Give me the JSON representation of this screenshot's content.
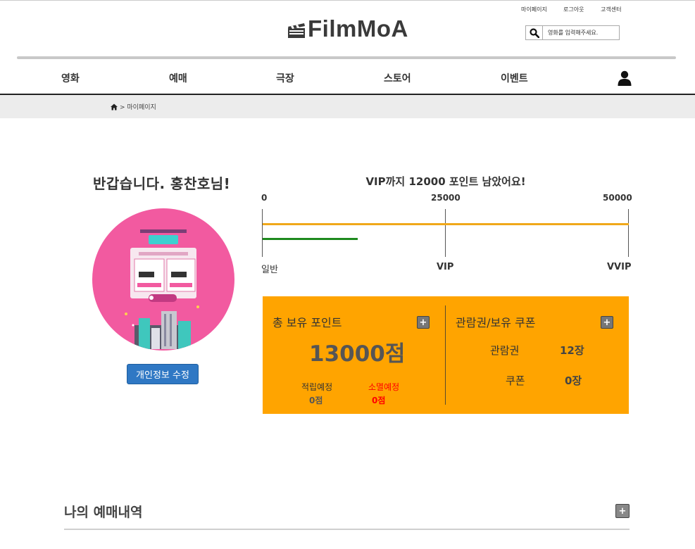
{
  "header": {
    "util_links": [
      "마이페이지",
      "로그아웃",
      "고객센터"
    ],
    "logo_text": "FilmMoA",
    "search_placeholder": "영화를 입력해주세요."
  },
  "nav": {
    "items": [
      "영화",
      "예매",
      "극장",
      "스토어",
      "이벤트"
    ]
  },
  "breadcrumb": {
    "text": "> 마이페이지"
  },
  "profile": {
    "greeting": "반갑습니다. 홍찬호님!",
    "edit_button": "개인정보 수정",
    "avatar_colors": {
      "background": "#f25aa0"
    }
  },
  "progress": {
    "message": "VIP까지 12000 포인트 남았어요!",
    "ticks": [
      "0",
      "25000",
      "50000"
    ],
    "tiers": [
      "일반",
      "VIP",
      "VVIP"
    ],
    "current_points": 13000,
    "max_points": 50000
  },
  "points_panel": {
    "title": "총 보유 포인트",
    "total": "13000점",
    "earn_label": "적립예정",
    "earn_value": "0점",
    "expire_label": "소멸예정",
    "expire_value": "0점",
    "plus": "+"
  },
  "coupon_panel": {
    "title": "관람권/보유 쿠폰",
    "rows": [
      {
        "label": "관람권",
        "value": "12장"
      },
      {
        "label": "쿠폰",
        "value": "0장"
      }
    ],
    "plus": "+"
  },
  "booking": {
    "title": "나의 예매내역",
    "plus": "+"
  },
  "colors": {
    "panel": "#ffa400",
    "track": "#f0a81a",
    "fill": "#1e8a1e",
    "edit_button": "#2f78c4",
    "expire": "#ff0000"
  }
}
